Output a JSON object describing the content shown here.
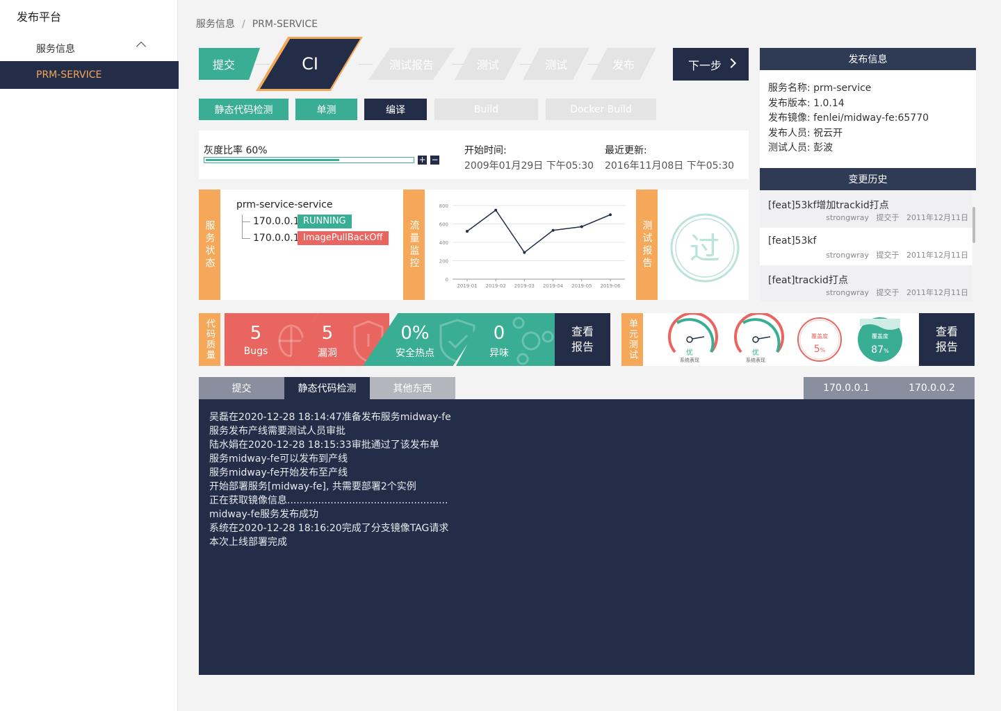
{
  "sidebar": {
    "app_title": "发布平台",
    "group_label": "服务信息",
    "active_item": "PRM-SERVICE"
  },
  "breadcrumb": {
    "parent": "服务信息",
    "separator": "/",
    "current": "PRM-SERVICE"
  },
  "pipeline": {
    "steps": [
      "提交",
      "CI",
      "测试报告",
      "测试",
      "测试",
      "发布"
    ],
    "next_label": "下一步"
  },
  "substeps": [
    "静态代码检测",
    "单测",
    "编译",
    "Build",
    "Docker Build"
  ],
  "gray": {
    "label": "灰度比率 60%",
    "ratio": 0.6,
    "plus": "+",
    "minus": "−",
    "start_label": "开始时间:",
    "start_value": "2009年01月29日 下午05:30",
    "update_label": "最近更新:",
    "update_value": "2016年11月08日  下午05:30"
  },
  "service_status": {
    "tab": "服务状态",
    "name": "prm-service-service",
    "instances": [
      {
        "ip": "170.0.0.1",
        "status": "RUNNING"
      },
      {
        "ip": "170.0.0.1",
        "status": "ImagePullBackOff"
      }
    ]
  },
  "traffic": {
    "tab": "流量监控"
  },
  "chart_data": {
    "type": "line",
    "categories": [
      "2019-01",
      "2019-02",
      "2019-03",
      "2019-04",
      "2019-05",
      "2019-06"
    ],
    "values": [
      520,
      750,
      290,
      530,
      570,
      700
    ],
    "ylim": [
      0,
      800
    ],
    "yticks": [
      0,
      200,
      400,
      600,
      800
    ],
    "grid": true,
    "color": "#232d47"
  },
  "test_report": {
    "tab": "测试报告",
    "stamp_char": "过"
  },
  "quality": {
    "tab": "代码质量",
    "cells": [
      {
        "num": "5",
        "label": "Bugs",
        "color": "#e8665f",
        "icon": "bug-icon"
      },
      {
        "num": "5",
        "label": "漏洞",
        "color": "#e8665f",
        "icon": "shield-warning-icon"
      },
      {
        "num": "0%",
        "label": "安全热点",
        "color": "#3aae95",
        "icon": "shield-check-icon"
      },
      {
        "num": "0",
        "label": "异味",
        "color": "#3aae95",
        "icon": "molecule-icon"
      }
    ],
    "report_line1": "查看",
    "report_line2": "报告"
  },
  "unit_test": {
    "tab": "单元测试",
    "gauges": [
      {
        "grade": "优",
        "caption": "系统表现"
      },
      {
        "grade": "优",
        "caption": "系统表现"
      }
    ],
    "coverage": [
      {
        "label": "覆盖度",
        "value": "5",
        "unit": "%",
        "color": "#e8665f"
      },
      {
        "label": "覆盖度",
        "value": "87",
        "unit": "%",
        "color": "#3aae95"
      }
    ],
    "report_line1": "查看",
    "report_line2": "报告"
  },
  "bottom_tabs": [
    "提交",
    "静态代码检测",
    "其他东西"
  ],
  "ip_tabs": [
    "170.0.0.1",
    "170.0.0.2"
  ],
  "console_lines": [
    "吴磊在2020-12-28 18:14:47准备发布服务midway-fe",
    "服务发布产线需要测试人员审批",
    "陆水娟在2020-12-28 18:15:33审批通过了该发布单",
    "服务midway-fe可以发布到产线",
    "服务midway-fe开始发布至产线",
    "开始部署服务[midway-fe], 共需要部署2个实例",
    "正在获取镜像信息....................................................",
    "midway-fe服务发布成功",
    "系统在2020-12-28 18:16:20完成了分支镜像TAG请求",
    "本次上线部署完成"
  ],
  "release_info": {
    "title": "发布信息",
    "lines": [
      "服务名称:  prm-service",
      "发布版本:  1.0.14",
      "发布镜像:  fenlei/midway-fe:65770",
      "发布人员:  祝云开",
      "测试人员:  彭波"
    ]
  },
  "history": {
    "title": "变更历史",
    "items": [
      {
        "title": "[feat]53kf增加trackid打点",
        "author": "strongwray",
        "action": "提交于",
        "date": "2011年12月11日"
      },
      {
        "title": "[feat]53kf",
        "author": "strongwray",
        "action": "提交于",
        "date": "2011年12月11日"
      },
      {
        "title": "[feat]trackid打点",
        "author": "strongwray",
        "action": "提交于",
        "date": "2011年12月11日"
      }
    ]
  }
}
